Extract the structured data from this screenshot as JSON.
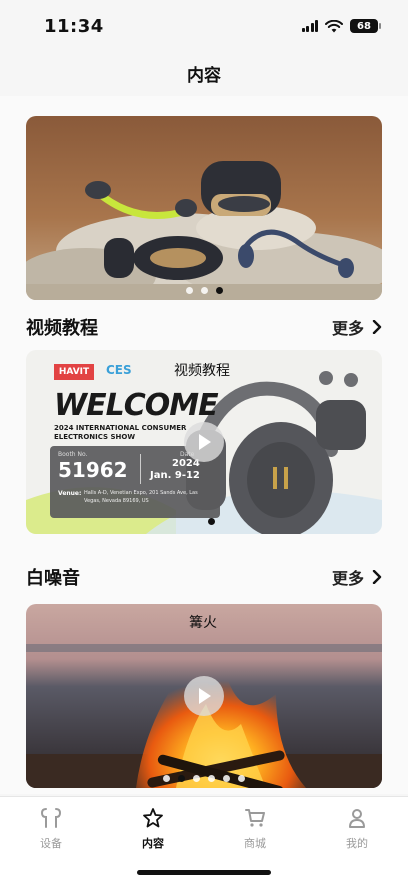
{
  "status_bar": {
    "time": "11:34",
    "battery": "68"
  },
  "header": {
    "title": "内容"
  },
  "banner": {
    "dots": 3,
    "active_dot": 2
  },
  "sections": {
    "video": {
      "title": "视频教程",
      "more": "更多",
      "card": {
        "title": "视频教程",
        "brand": "HAVIT",
        "event": "CES",
        "headline": "WELCOME",
        "subline1": "2024 INTERNATIONAL CONSUMER",
        "subline2": "ELECTRONICS SHOW",
        "booth_label": "Booth No.",
        "booth_no": "51962",
        "date_label": "Date",
        "year": "2024",
        "dates": "Jan. 9-12",
        "venue_label": "Venue:",
        "venue_line1": "Halls A-D, Venetian Expo, 201 Sands Ave, Las",
        "venue_line2": "Vegas, Nevada 89169, US"
      }
    },
    "noise": {
      "title": "白噪音",
      "more": "更多",
      "card": {
        "title": "篝火",
        "dots": 6,
        "active_dot": 1
      }
    }
  },
  "tabs": [
    {
      "label": "设备",
      "icon": "earbuds-icon",
      "active": false
    },
    {
      "label": "内容",
      "icon": "star-icon",
      "active": true
    },
    {
      "label": "商城",
      "icon": "cart-icon",
      "active": false
    },
    {
      "label": "我的",
      "icon": "person-icon",
      "active": false
    }
  ],
  "colors": {
    "accent_yellow": "#c8e63c",
    "active_tab": "#111111",
    "inactive_tab": "#9a9a9a"
  }
}
